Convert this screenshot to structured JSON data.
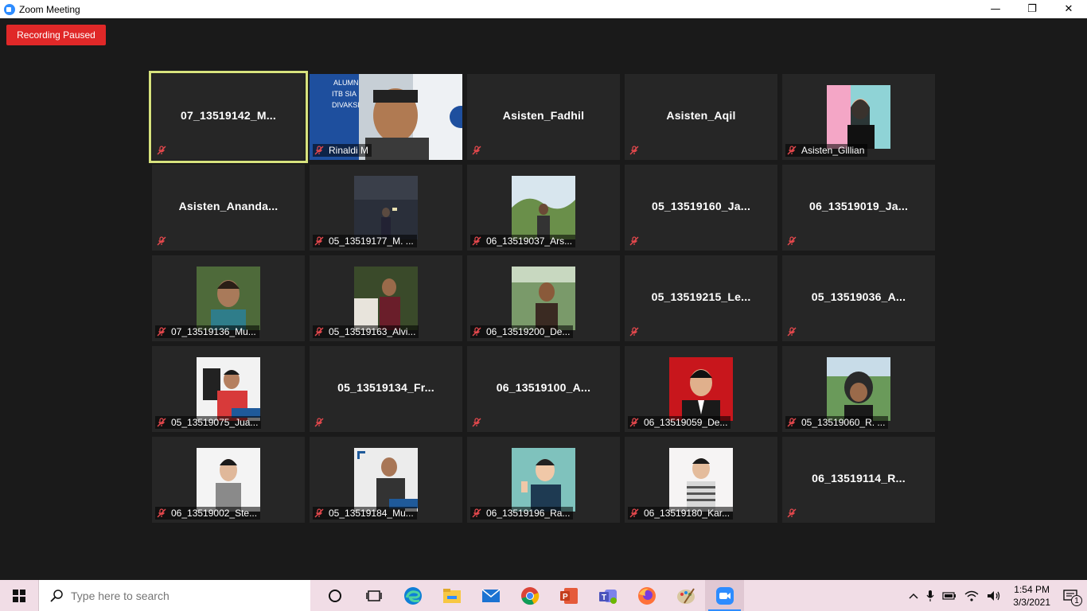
{
  "window": {
    "title": "Zoom Meeting",
    "minimize_glyph": "—",
    "restore_glyph": "❐",
    "close_glyph": "✕"
  },
  "meeting": {
    "recording_badge": "Recording Paused",
    "tiles": [
      {
        "id": "t0",
        "kind": "name",
        "big": "07_13519142_M...",
        "label": "",
        "active": true
      },
      {
        "id": "t1",
        "kind": "video",
        "big": "",
        "label": "Rinaldi M"
      },
      {
        "id": "t2",
        "kind": "name",
        "big": "Asisten_Fadhil",
        "label": ""
      },
      {
        "id": "t3",
        "kind": "name",
        "big": "Asisten_Aqil",
        "label": ""
      },
      {
        "id": "t4",
        "kind": "photo",
        "big": "",
        "label": "Asisten_Gillian"
      },
      {
        "id": "t5",
        "kind": "name",
        "big": "Asisten_Ananda...",
        "label": ""
      },
      {
        "id": "t6",
        "kind": "photo",
        "big": "",
        "label": "05_13519177_M. ..."
      },
      {
        "id": "t7",
        "kind": "photo",
        "big": "",
        "label": "06_13519037_Ars..."
      },
      {
        "id": "t8",
        "kind": "name",
        "big": "05_13519160_Ja...",
        "label": ""
      },
      {
        "id": "t9",
        "kind": "name",
        "big": "06_13519019_Ja...",
        "label": ""
      },
      {
        "id": "t10",
        "kind": "photo",
        "big": "",
        "label": "07_13519136_Mu..."
      },
      {
        "id": "t11",
        "kind": "photo",
        "big": "",
        "label": "05_13519163_Alvi..."
      },
      {
        "id": "t12",
        "kind": "photo",
        "big": "",
        "label": "06_13519200_De..."
      },
      {
        "id": "t13",
        "kind": "name",
        "big": "05_13519215_Le...",
        "label": ""
      },
      {
        "id": "t14",
        "kind": "name",
        "big": "05_13519036_A...",
        "label": ""
      },
      {
        "id": "t15",
        "kind": "photo",
        "big": "",
        "label": "05_13519075_Jua..."
      },
      {
        "id": "t16",
        "kind": "name",
        "big": "05_13519134_Fr...",
        "label": ""
      },
      {
        "id": "t17",
        "kind": "name",
        "big": "06_13519100_A...",
        "label": ""
      },
      {
        "id": "t18",
        "kind": "photo",
        "big": "",
        "label": "06_13519059_De..."
      },
      {
        "id": "t19",
        "kind": "photo",
        "big": "",
        "label": "05_13519060_R. ..."
      },
      {
        "id": "t20",
        "kind": "photo",
        "big": "",
        "label": "06_13519002_Ste..."
      },
      {
        "id": "t21",
        "kind": "photo",
        "big": "",
        "label": "05_13519184_Mu..."
      },
      {
        "id": "t22",
        "kind": "photo",
        "big": "",
        "label": "06_13519196_Ra..."
      },
      {
        "id": "t23",
        "kind": "photo",
        "big": "",
        "label": "06_13519180_Kar..."
      },
      {
        "id": "t24",
        "kind": "name",
        "big": "06_13519114_R...",
        "label": ""
      }
    ]
  },
  "taskbar": {
    "search_placeholder": "Type here to search",
    "apps": [
      "task-view-icon",
      "edge-icon",
      "file-explorer-icon",
      "mail-icon",
      "chrome-icon",
      "powerpoint-icon",
      "teams-icon",
      "firefox-icon",
      "paint-icon",
      "zoom-icon"
    ],
    "clock_time": "1:54 PM",
    "clock_date": "3/3/2021",
    "notification_count": "1"
  },
  "colors": {
    "accent": "#2d8cff",
    "recording": "#e02828",
    "active_speaker": "#d7e27d",
    "muted": "#e5484d"
  }
}
